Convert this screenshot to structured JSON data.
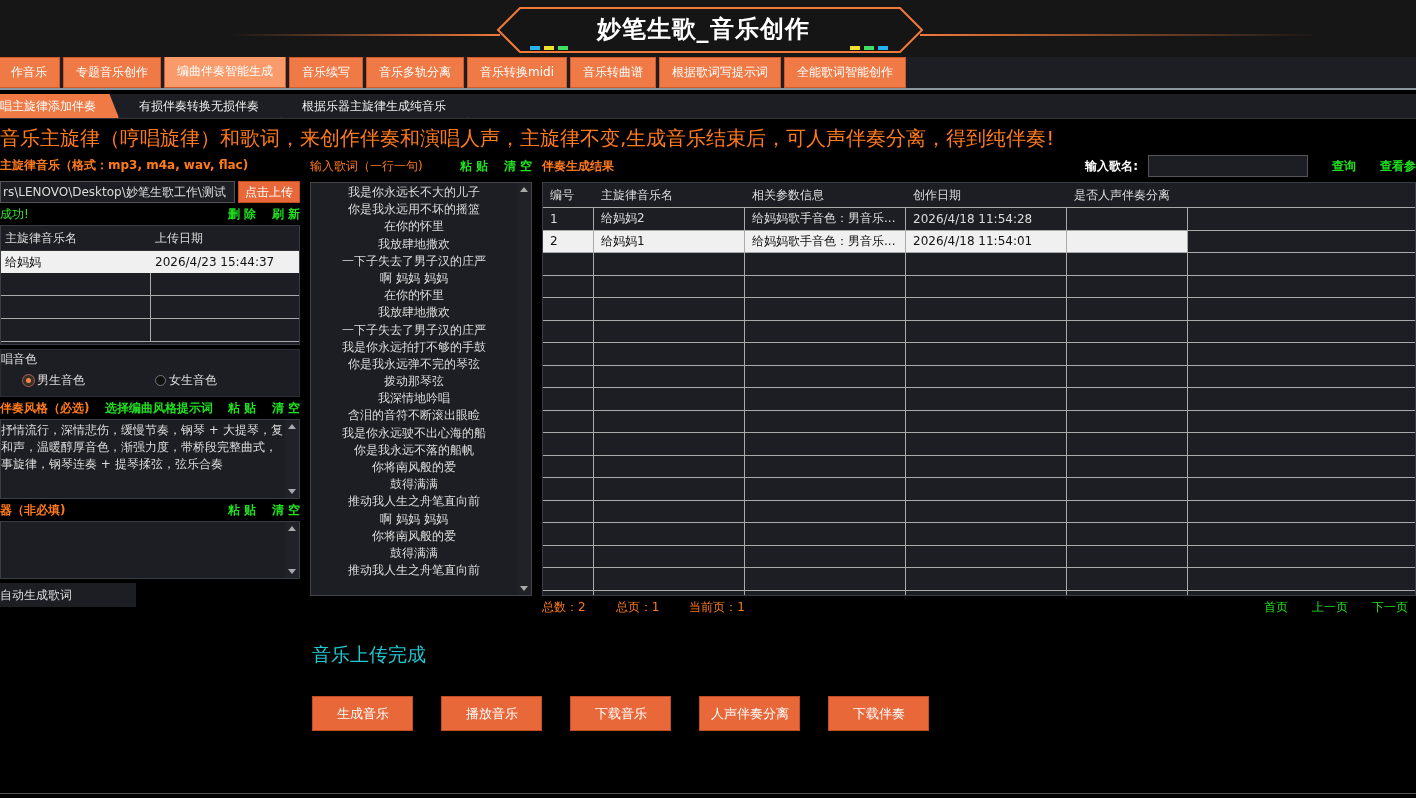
{
  "window": {
    "title": "妙笔生歌_音乐创作"
  },
  "tabs": [
    {
      "label": "作音乐",
      "selected": false
    },
    {
      "label": "专题音乐创作",
      "selected": false
    },
    {
      "label": "编曲伴奏智能生成",
      "selected": true
    },
    {
      "label": "音乐续写",
      "selected": false
    },
    {
      "label": "音乐多轨分离",
      "selected": false
    },
    {
      "label": "音乐转换midi",
      "selected": false
    },
    {
      "label": "音乐转曲谱",
      "selected": false
    },
    {
      "label": "根据歌词写提示词",
      "selected": false
    },
    {
      "label": "全能歌词智能创作",
      "selected": false
    }
  ],
  "subtabs": [
    {
      "label": "唱主旋律添加伴奏",
      "selected": true
    },
    {
      "label": "有损伴奏转换无损伴奏",
      "selected": false
    },
    {
      "label": "根据乐器主旋律生成纯音乐",
      "selected": false
    }
  ],
  "headline": "音乐主旋律（哼唱旋律）和歌词，来创作伴奏和演唱人声，主旋律不变,生成音乐结束后，可人声伴奏分离，得到纯伴奏!",
  "melody": {
    "label": "主旋律音乐（格式：mp3, m4a, wav, flac)",
    "path": "rs\\LENOVO\\Desktop\\妙笔生歌工作\\测试",
    "upload_button": "点击上传",
    "status": "成功!",
    "actions": [
      "删 除",
      "刷 新"
    ],
    "columns": [
      "主旋律音乐名",
      "上传日期"
    ],
    "rows": [
      {
        "cells": [
          "给妈妈",
          "2026/4/23 15:44:37"
        ],
        "selected": true
      }
    ]
  },
  "voice": {
    "label": "唱音色",
    "options": [
      {
        "label": "男生音色",
        "selected": true
      },
      {
        "label": "女生音色",
        "selected": false
      }
    ]
  },
  "style": {
    "label": "伴奏风格（必选)",
    "hint_link": "选择编曲风格提示词",
    "actions": [
      "粘 贴",
      "清 空"
    ],
    "lines": [
      "抒情流行，深情悲伤，缓慢节奏，钢琴 + 大提琴，复",
      "和声，温暖醇厚音色，渐强力度，带桥段完整曲式，",
      "事旋律，钢琴连奏 + 提琴揉弦，弦乐合奏"
    ]
  },
  "instrument": {
    "label": "器（非必填)",
    "actions": [
      "粘 贴",
      "清 空"
    ]
  },
  "auto_lyrics_button": "自动生成歌词",
  "lyrics": {
    "label": "输入歌词（一行一句)",
    "actions": [
      "粘 贴",
      "清 空"
    ],
    "lines": [
      "我是你永远长不大的儿子",
      "你是我永远用不坏的摇篮",
      "在你的怀里",
      "我放肆地撒欢",
      "一下子失去了男子汉的庄严",
      "啊 妈妈 妈妈",
      "在你的怀里",
      "我放肆地撒欢",
      "一下子失去了男子汉的庄严",
      "我是你永远拍打不够的手鼓",
      "你是我永远弹不完的琴弦",
      "拨动那琴弦",
      "我深情地吟唱",
      "含泪的音符不断滚出眼睑",
      "我是你永远驶不出心海的船",
      "你是我永远不落的船帆",
      "你将南风般的爱",
      "鼓得满满",
      "推动我人生之舟笔直向前",
      "啊 妈妈 妈妈",
      "你将南风般的爱",
      "鼓得满满",
      "推动我人生之舟笔直向前"
    ]
  },
  "results": {
    "label": "伴奏生成结果",
    "search_label": "输入歌名:",
    "search_button": "查询",
    "view_link": "查看参",
    "columns": [
      "编号",
      "主旋律音乐名",
      "相关参数信息",
      "创作日期",
      "是否人声伴奏分离"
    ],
    "rows": [
      {
        "cells": [
          "1",
          "给妈妈2",
          "给妈妈歌手音色：男音乐...",
          "2026/4/18 11:54:28",
          ""
        ],
        "selected": false
      },
      {
        "cells": [
          "2",
          "给妈妈1",
          "给妈妈歌手音色：男音乐...",
          "2026/4/18 11:54:01",
          ""
        ],
        "selected": true
      }
    ],
    "pager": {
      "total": "总数：2",
      "pages": "总页：1",
      "current": "当前页：1",
      "links": [
        "首页",
        "上一页",
        "下一页"
      ]
    }
  },
  "status_message": "音乐上传完成",
  "buttons": [
    "生成音乐",
    "播放音乐",
    "下载音乐",
    "人声伴奏分离",
    "下载伴奏"
  ]
}
